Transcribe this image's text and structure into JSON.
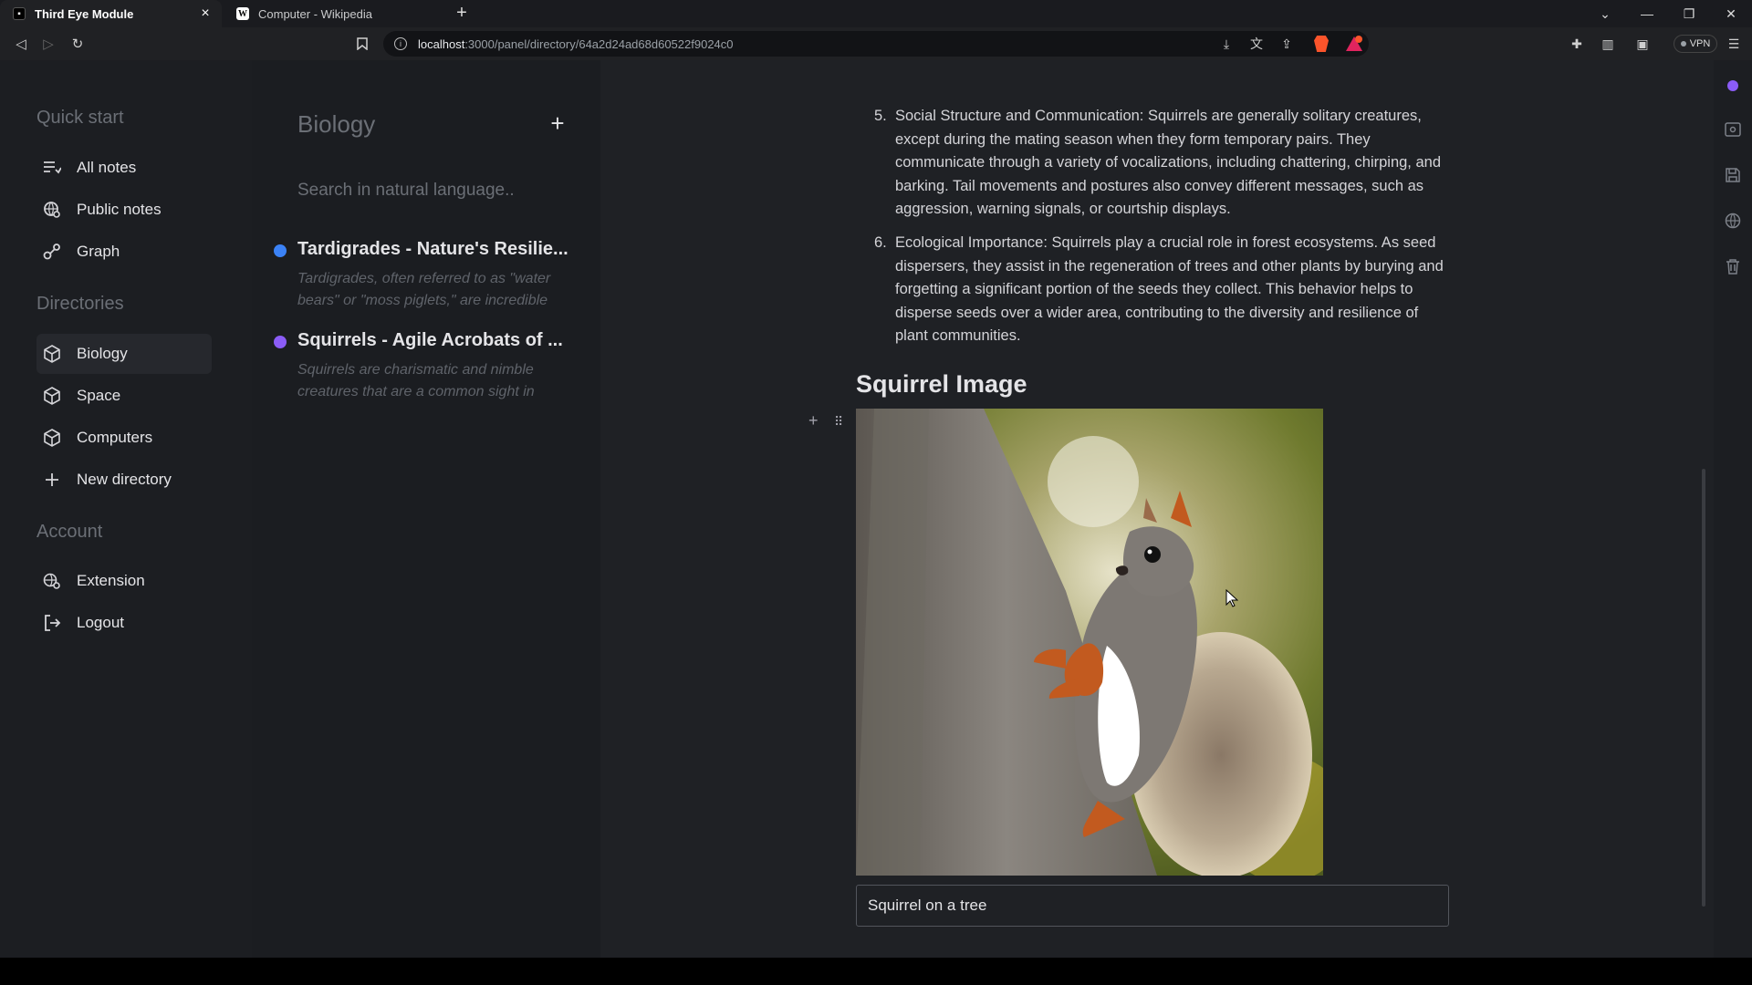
{
  "browser": {
    "tabs": [
      {
        "title": "Third Eye Module",
        "favicon": "app-icon",
        "active": true
      },
      {
        "title": "Computer - Wikipedia",
        "favicon": "wikipedia-icon",
        "active": false
      }
    ],
    "new_tab_label": "+",
    "url_host": "localhost",
    "url_rest": ":3000/panel/directory/64a2d24ad68d60522f9024c0",
    "vpn_label": "VPN"
  },
  "sidebar": {
    "quick_start_label": "Quick start",
    "quick_items": [
      {
        "label": "All notes",
        "icon": "list-icon"
      },
      {
        "label": "Public notes",
        "icon": "globe-search-icon"
      },
      {
        "label": "Graph",
        "icon": "graph-icon"
      }
    ],
    "directories_label": "Directories",
    "directories": [
      {
        "label": "Biology",
        "icon": "cube-icon",
        "selected": true
      },
      {
        "label": "Space",
        "icon": "cube-icon",
        "selected": false
      },
      {
        "label": "Computers",
        "icon": "cube-icon",
        "selected": false
      },
      {
        "label": "New directory",
        "icon": "plus-icon",
        "selected": false
      }
    ],
    "account_label": "Account",
    "account_items": [
      {
        "label": "Extension",
        "icon": "extension-icon"
      },
      {
        "label": "Logout",
        "icon": "logout-icon"
      }
    ]
  },
  "notes_panel": {
    "directory_title": "Biology",
    "add_label": "+",
    "search_placeholder": "Search in natural language..",
    "notes": [
      {
        "title": "Tardigrades - Nature's Resilie...",
        "excerpt": "Tardigrades, often referred to as \"water bears\" or \"moss piglets,\" are incredible",
        "dot_color": "#3b82f6"
      },
      {
        "title": "Squirrels - Agile Acrobats of ...",
        "excerpt": "Squirrels are charismatic and nimble creatures that are a common sight in",
        "dot_color": "#8b5cf6"
      }
    ]
  },
  "editor": {
    "list_items": [
      {
        "number": "5.",
        "text": "Social Structure and Communication: Squirrels are generally solitary creatures, except during the mating season when they form temporary pairs. They communicate through a variety of vocalizations, including chattering, chirping, and barking. Tail movements and postures also convey different messages, such as aggression, warning signals, or courtship displays."
      },
      {
        "number": "6.",
        "text": "Ecological Importance: Squirrels play a crucial role in forest ecosystems. As seed dispersers, they assist in the regeneration of trees and other plants by burying and forgetting a significant portion of the seeds they collect. This behavior helps to disperse seeds over a wider area, contributing to the diversity and resilience of plant communities."
      }
    ],
    "section_heading": "Squirrel Image",
    "image_caption": "Squirrel on a tree"
  },
  "right_toolbar": {
    "icons": [
      "status-dot-icon",
      "preview-icon",
      "save-icon",
      "globe-icon",
      "trash-icon"
    ],
    "accent": "#8b5cf6"
  }
}
